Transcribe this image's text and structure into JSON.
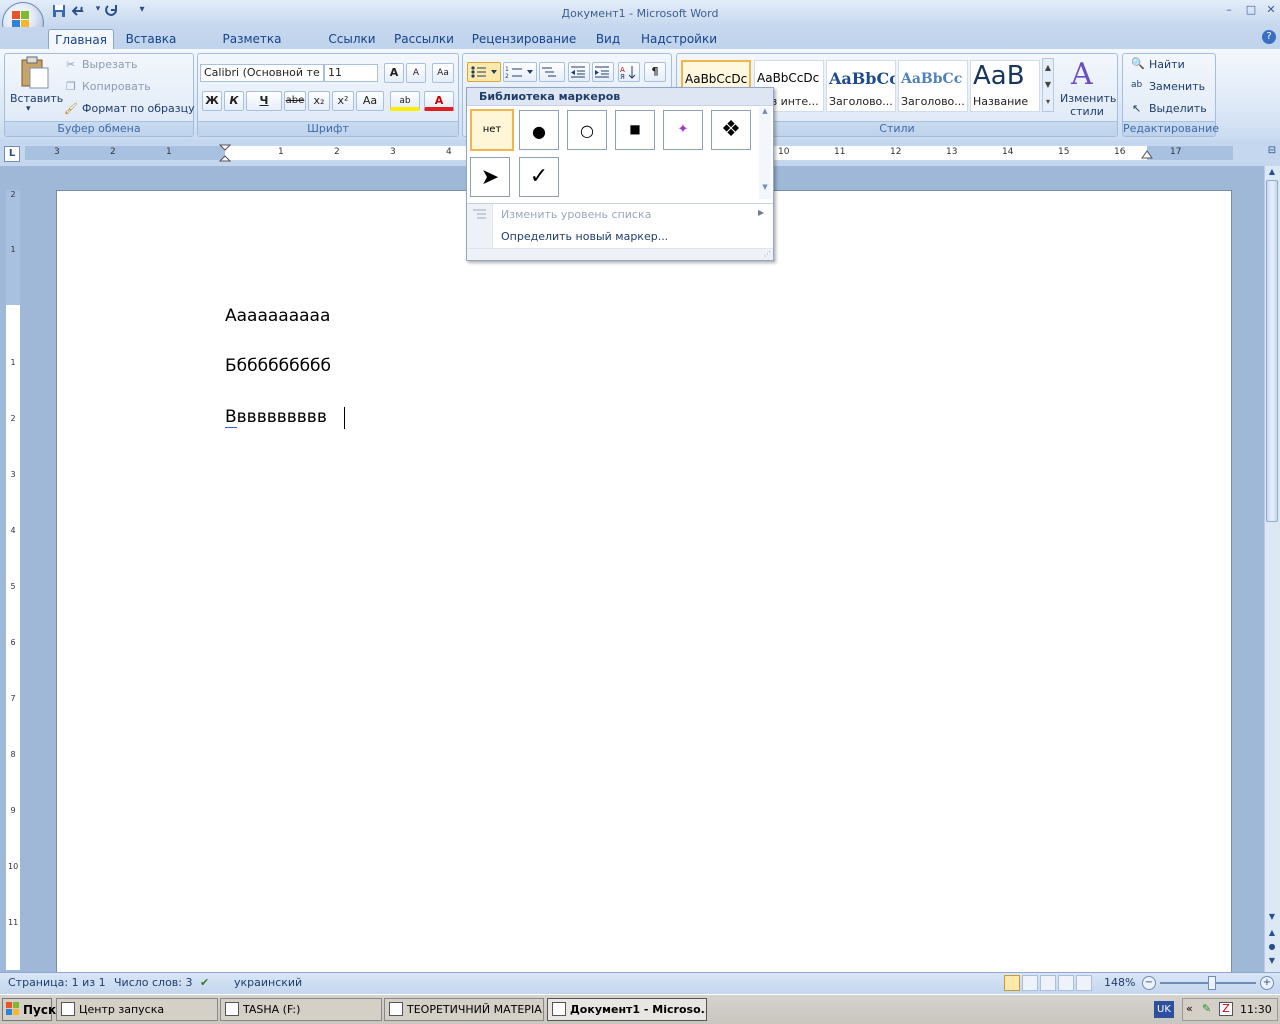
{
  "window": {
    "title": "Документ1 - Microsoft Word",
    "min": "–",
    "max": "□",
    "close": "✕"
  },
  "quick_access": {
    "save": "save-icon",
    "undo": "undo-icon",
    "redo": "redo-icon",
    "customize": "▾"
  },
  "tabs": [
    "Главная",
    "Вставка",
    "Разметка страницы",
    "Ссылки",
    "Рассылки",
    "Рецензирование",
    "Вид",
    "Надстройки"
  ],
  "active_tab": "Главная",
  "help": "?",
  "clipboard": {
    "paste": "Вставить",
    "cut": "Вырезать",
    "copy": "Копировать",
    "format_painter": "Формат по образцу",
    "label": "Буфер обмена"
  },
  "font": {
    "name": "Calibri (Основной те",
    "size": "11",
    "grow": "A",
    "shrink": "A",
    "clear": "Aa",
    "bold": "Ж",
    "italic": "К",
    "underline": "Ч",
    "strike": "abe",
    "sub": "x₂",
    "sup": "x²",
    "case": "Aa",
    "highlight": "ab",
    "color": "A",
    "label": "Шрифт"
  },
  "paragraph": {
    "pilcrow": "¶"
  },
  "styles": {
    "items": [
      {
        "sample": "AaBbCcDc",
        "name": ""
      },
      {
        "sample": "AaBbCcDc",
        "name": "Без инте..."
      },
      {
        "sample": "AaBbCc",
        "name": "Заголово..."
      },
      {
        "sample": "AaBbCc",
        "name": "Заголово..."
      },
      {
        "sample": "AaB",
        "name": "Название"
      }
    ],
    "change": "Изменить стили",
    "label": "Стили"
  },
  "editing": {
    "find": "Найти",
    "replace": "Заменить",
    "select": "Выделить",
    "label": "Редактирование"
  },
  "bullet_menu": {
    "header": "Библиотека маркеров",
    "none_label": "нет",
    "bullets": [
      "●",
      "○",
      "■",
      "✦",
      "❖",
      "➤",
      "✓"
    ],
    "change_level": "Изменить уровень списка",
    "define_new": "Определить новый маркер..."
  },
  "ruler": {
    "corner": "L",
    "h_numbers": [
      "3",
      "2",
      "1",
      "1",
      "2",
      "3",
      "4",
      "10",
      "11",
      "12",
      "13",
      "14",
      "15",
      "16",
      "17"
    ],
    "v_numbers": [
      "2",
      "1",
      "1",
      "2",
      "3",
      "4",
      "5",
      "6",
      "7",
      "8",
      "9",
      "10",
      "11"
    ]
  },
  "document": {
    "lines": [
      "Аааааааааа",
      "Бббббббббб",
      "Вввввввввв"
    ]
  },
  "status": {
    "page": "Страница: 1 из 1",
    "words": "Число слов: 3",
    "language": "украинский",
    "zoom": "148%"
  },
  "taskbar": {
    "start": "Пуск",
    "buttons": [
      "Центр запуска",
      "TASHA (F:)",
      "ТЕОРЕТИЧНИЙ МАТЕРІА...",
      "Документ1 - Microso..."
    ],
    "lang": "UK",
    "clock": "11:30",
    "chevron": "«"
  }
}
